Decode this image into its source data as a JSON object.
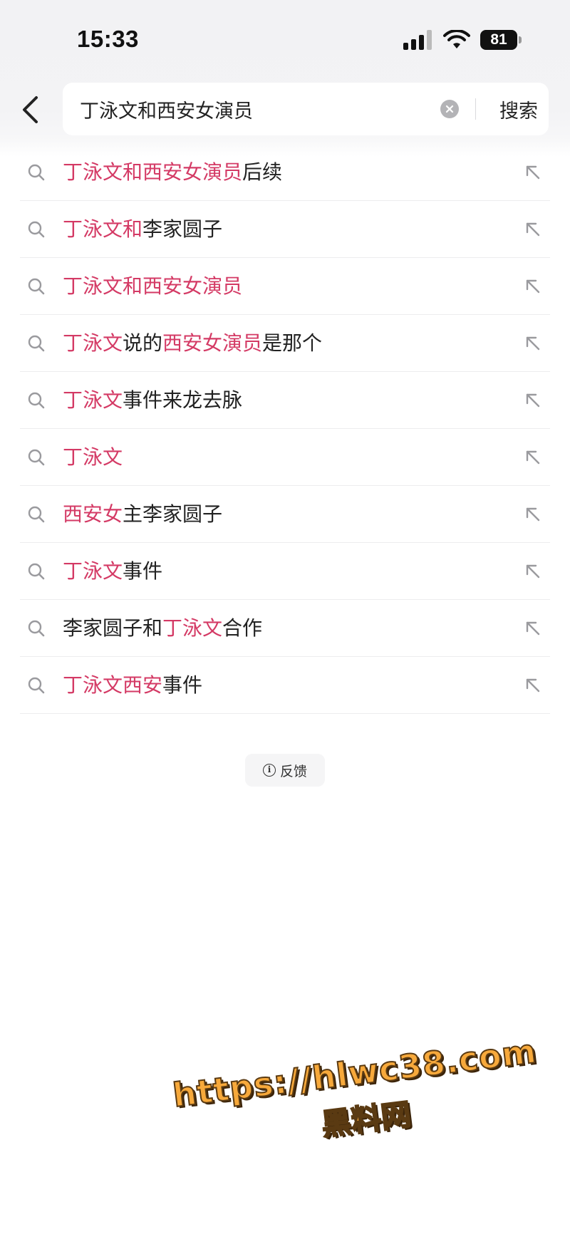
{
  "status_bar": {
    "time": "15:33",
    "battery": "81"
  },
  "search": {
    "query": "丁泳文和西安女演员",
    "submit_label": "搜索"
  },
  "suggestions": [
    {
      "parts": [
        {
          "text": "丁泳文和西安女演员",
          "hl": true
        },
        {
          "text": "后续",
          "hl": false
        }
      ]
    },
    {
      "parts": [
        {
          "text": "丁泳文和",
          "hl": true
        },
        {
          "text": "李家圆子",
          "hl": false
        }
      ]
    },
    {
      "parts": [
        {
          "text": "丁泳文和西安女演员",
          "hl": true
        }
      ]
    },
    {
      "parts": [
        {
          "text": "丁泳文",
          "hl": true
        },
        {
          "text": "说的",
          "hl": false
        },
        {
          "text": "西安女演员",
          "hl": true
        },
        {
          "text": "是那个",
          "hl": false
        }
      ]
    },
    {
      "parts": [
        {
          "text": "丁泳文",
          "hl": true
        },
        {
          "text": "事件来龙去脉",
          "hl": false
        }
      ]
    },
    {
      "parts": [
        {
          "text": "丁泳文",
          "hl": true
        }
      ]
    },
    {
      "parts": [
        {
          "text": "西安女",
          "hl": true
        },
        {
          "text": "主李家圆子",
          "hl": false
        }
      ]
    },
    {
      "parts": [
        {
          "text": "丁泳文",
          "hl": true
        },
        {
          "text": "事件",
          "hl": false
        }
      ]
    },
    {
      "parts": [
        {
          "text": "李家圆子和",
          "hl": false
        },
        {
          "text": "丁泳文",
          "hl": true
        },
        {
          "text": "合作",
          "hl": false
        }
      ]
    },
    {
      "parts": [
        {
          "text": "丁泳文西安",
          "hl": true
        },
        {
          "text": "事件",
          "hl": false
        }
      ]
    }
  ],
  "feedback": {
    "icon_char": "i",
    "label": "反馈"
  },
  "watermark": {
    "line1": "https://hlwc38.com",
    "line2": "黑料网"
  },
  "colors": {
    "highlight": "#d43a65",
    "text": "#222222",
    "icon_gray": "#9a9a9e",
    "watermark_fill": "#f7a93b"
  }
}
